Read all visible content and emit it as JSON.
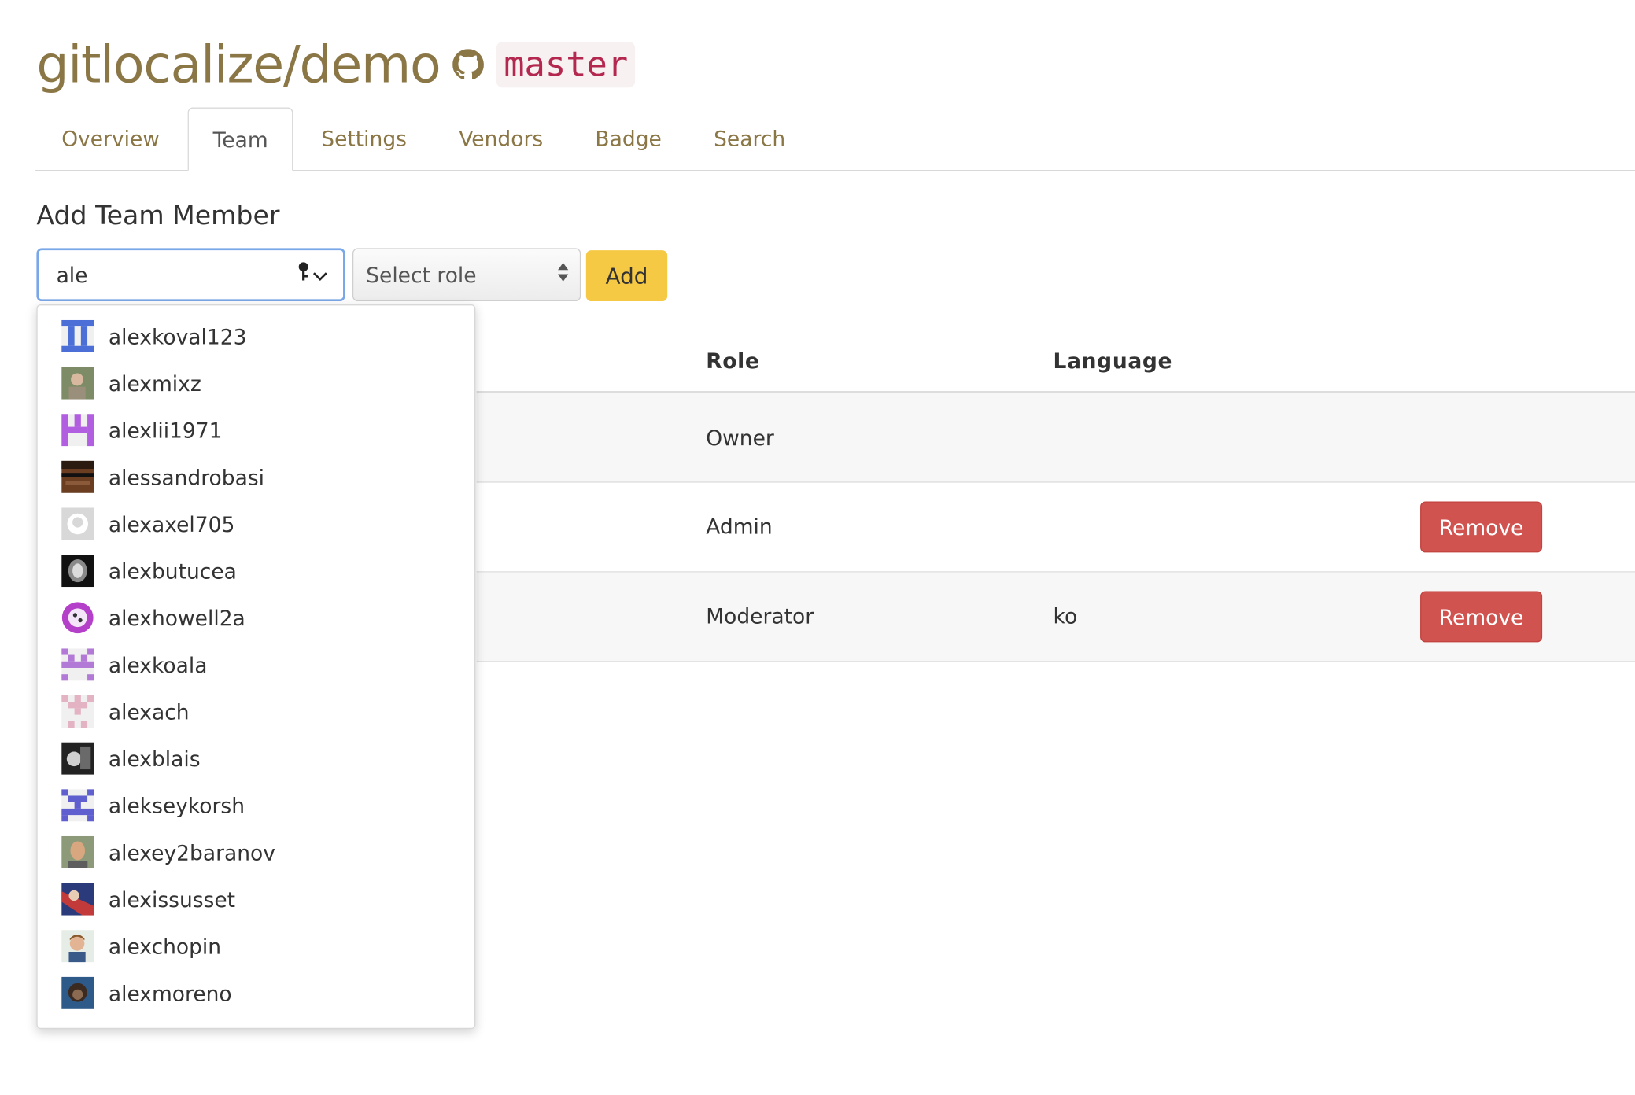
{
  "repo": {
    "title": "gitlocalize/demo",
    "branch": "master"
  },
  "tabs": [
    {
      "label": "Overview"
    },
    {
      "label": "Team"
    },
    {
      "label": "Settings"
    },
    {
      "label": "Vendors"
    },
    {
      "label": "Badge"
    },
    {
      "label": "Search"
    }
  ],
  "active_tab": "Team",
  "add_member": {
    "title": "Add Team Member",
    "user_input_value": "ale",
    "role_placeholder": "Select role",
    "add_label": "Add"
  },
  "table": {
    "columns": [
      "Role",
      "Language"
    ],
    "rows": [
      {
        "role": "Owner",
        "language": "",
        "action": ""
      },
      {
        "role": "Admin",
        "language": "",
        "action": "Remove"
      },
      {
        "role": "Moderator",
        "language": "ko",
        "action": "Remove"
      }
    ]
  },
  "colors": {
    "brand": "#8b7646",
    "branch": "#b4284f",
    "add_button": "#f6c945",
    "remove_button": "#d0534f",
    "focus_border": "#7aa7e8"
  },
  "suggestions": [
    {
      "username": "alexkoval123",
      "avatar": "identicon-blue"
    },
    {
      "username": "alexmixz",
      "avatar": "photo-avatar"
    },
    {
      "username": "alexlii1971",
      "avatar": "identicon-purple"
    },
    {
      "username": "alessandrobasi",
      "avatar": "pixel-face-avatar"
    },
    {
      "username": "alexaxel705",
      "avatar": "github-default-avatar"
    },
    {
      "username": "alexbutucea",
      "avatar": "photo-avatar"
    },
    {
      "username": "alexhowell2a",
      "avatar": "cartoon-avatar"
    },
    {
      "username": "alexkoala",
      "avatar": "identicon-lavender"
    },
    {
      "username": "alexach",
      "avatar": "identicon-pink"
    },
    {
      "username": "alexblais",
      "avatar": "photo-avatar"
    },
    {
      "username": "alekseykorsh",
      "avatar": "identicon-indigo"
    },
    {
      "username": "alexey2baranov",
      "avatar": "photo-avatar"
    },
    {
      "username": "alexissusset",
      "avatar": "photo-avatar"
    },
    {
      "username": "alexchopin",
      "avatar": "photo-avatar"
    },
    {
      "username": "alexmoreno",
      "avatar": "photo-avatar"
    }
  ]
}
